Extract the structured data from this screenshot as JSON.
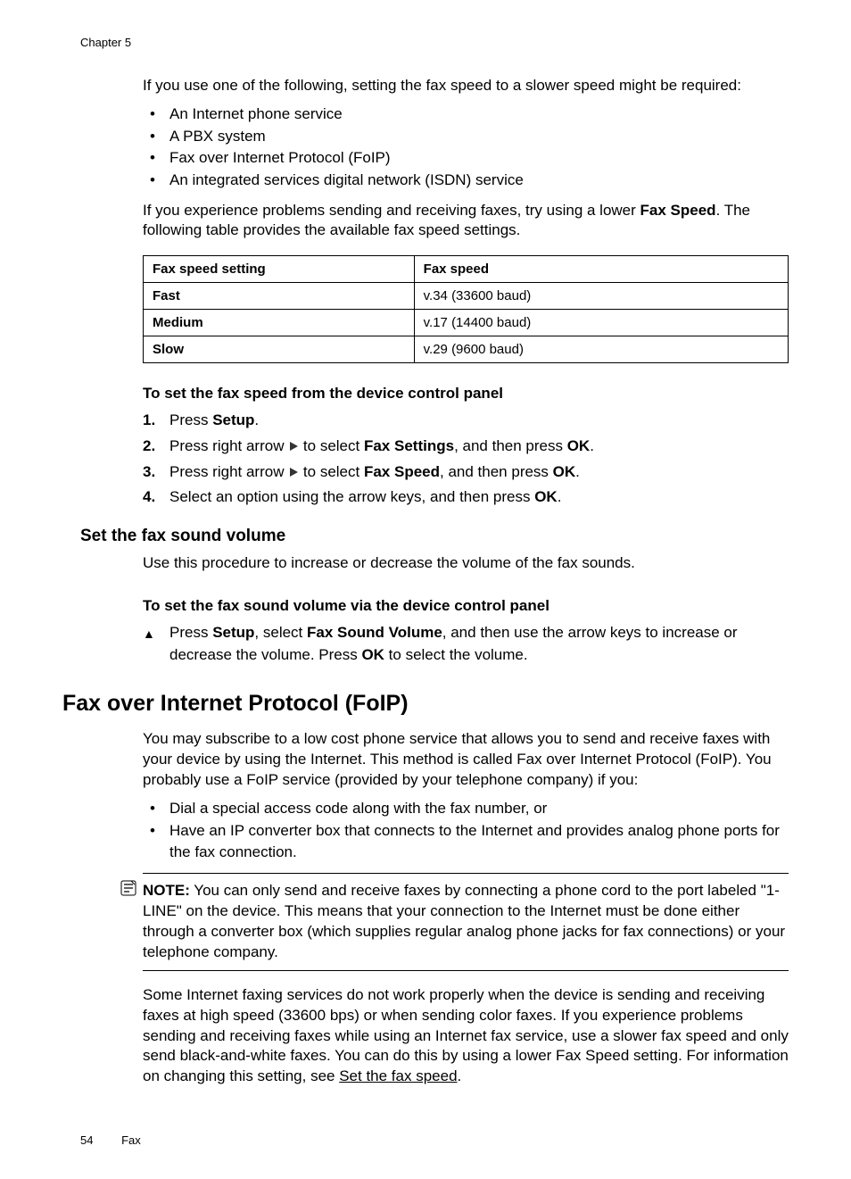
{
  "chapter_header": "Chapter 5",
  "intro": "If you use one of the following, setting the fax speed to a slower speed might be required:",
  "bullets1": [
    "An Internet phone service",
    "A PBX system",
    "Fax over Internet Protocol (FoIP)",
    "An integrated services digital network (ISDN) service"
  ],
  "para2a": "If you experience problems sending and receiving faxes, try using a lower ",
  "para2b": "Fax Speed",
  "para2c": ". The following table provides the available fax speed settings.",
  "table": {
    "h1": "Fax speed setting",
    "h2": "Fax speed",
    "rows": [
      {
        "c1": "Fast",
        "c2": "v.34 (33600 baud)"
      },
      {
        "c1": "Medium",
        "c2": "v.17 (14400 baud)"
      },
      {
        "c1": "Slow",
        "c2": "v.29 (9600 baud)"
      }
    ]
  },
  "proc1_title": "To set the fax speed from the device control panel",
  "steps1": {
    "s1_pre": "Press ",
    "s1_b": "Setup",
    "s1_post": ".",
    "s2_pre": "Press right arrow ",
    "s2_mid": " to select ",
    "s2_b1": "Fax Settings",
    "s2_mid2": ", and then press ",
    "s2_b2": "OK",
    "s2_post": ".",
    "s3_pre": "Press right arrow ",
    "s3_mid": " to select ",
    "s3_b1": "Fax Speed",
    "s3_mid2": ", and then press ",
    "s3_b2": "OK",
    "s3_post": ".",
    "s4_pre": "Select an option using the arrow keys, and then press ",
    "s4_b": "OK",
    "s4_post": "."
  },
  "h3_sound": "Set the fax sound volume",
  "sound_intro": "Use this procedure to increase or decrease the volume of the fax sounds.",
  "proc2_title": "To set the fax sound volume via the device control panel",
  "proc2_step_pre": "Press ",
  "proc2_b1": "Setup",
  "proc2_mid1": ", select ",
  "proc2_b2": "Fax Sound Volume",
  "proc2_mid2": ", and then use the arrow keys to increase or decrease the volume. Press ",
  "proc2_b3": "OK",
  "proc2_post": " to select the volume.",
  "h2_foip": "Fax over Internet Protocol (FoIP)",
  "foip_p1": "You may subscribe to a low cost phone service that allows you to send and receive faxes with your device by using the Internet. This method is called Fax over Internet Protocol (FoIP). You probably use a FoIP service (provided by your telephone company) if you:",
  "foip_bullets": [
    "Dial a special access code along with the fax number, or",
    "Have an IP converter box that connects to the Internet and provides analog phone ports for the fax connection."
  ],
  "note_label": "NOTE:",
  "note_text": " You can only send and receive faxes by connecting a phone cord to the port labeled \"1-LINE\" on the device. This means that your connection to the Internet must be done either through a converter box (which supplies regular analog phone jacks for fax connections) or your telephone company.",
  "foip_p2_pre": "Some Internet faxing services do not work properly when the device is sending and receiving faxes at high speed (33600 bps) or when sending color faxes. If you experience problems sending and receiving faxes while using an Internet fax service, use a slower fax speed and only send black-and-white faxes. You can do this by using a lower Fax Speed setting. For information on changing this setting, see ",
  "foip_p2_link": "Set the fax speed",
  "foip_p2_post": ".",
  "footer": {
    "page": "54",
    "section": "Fax"
  }
}
